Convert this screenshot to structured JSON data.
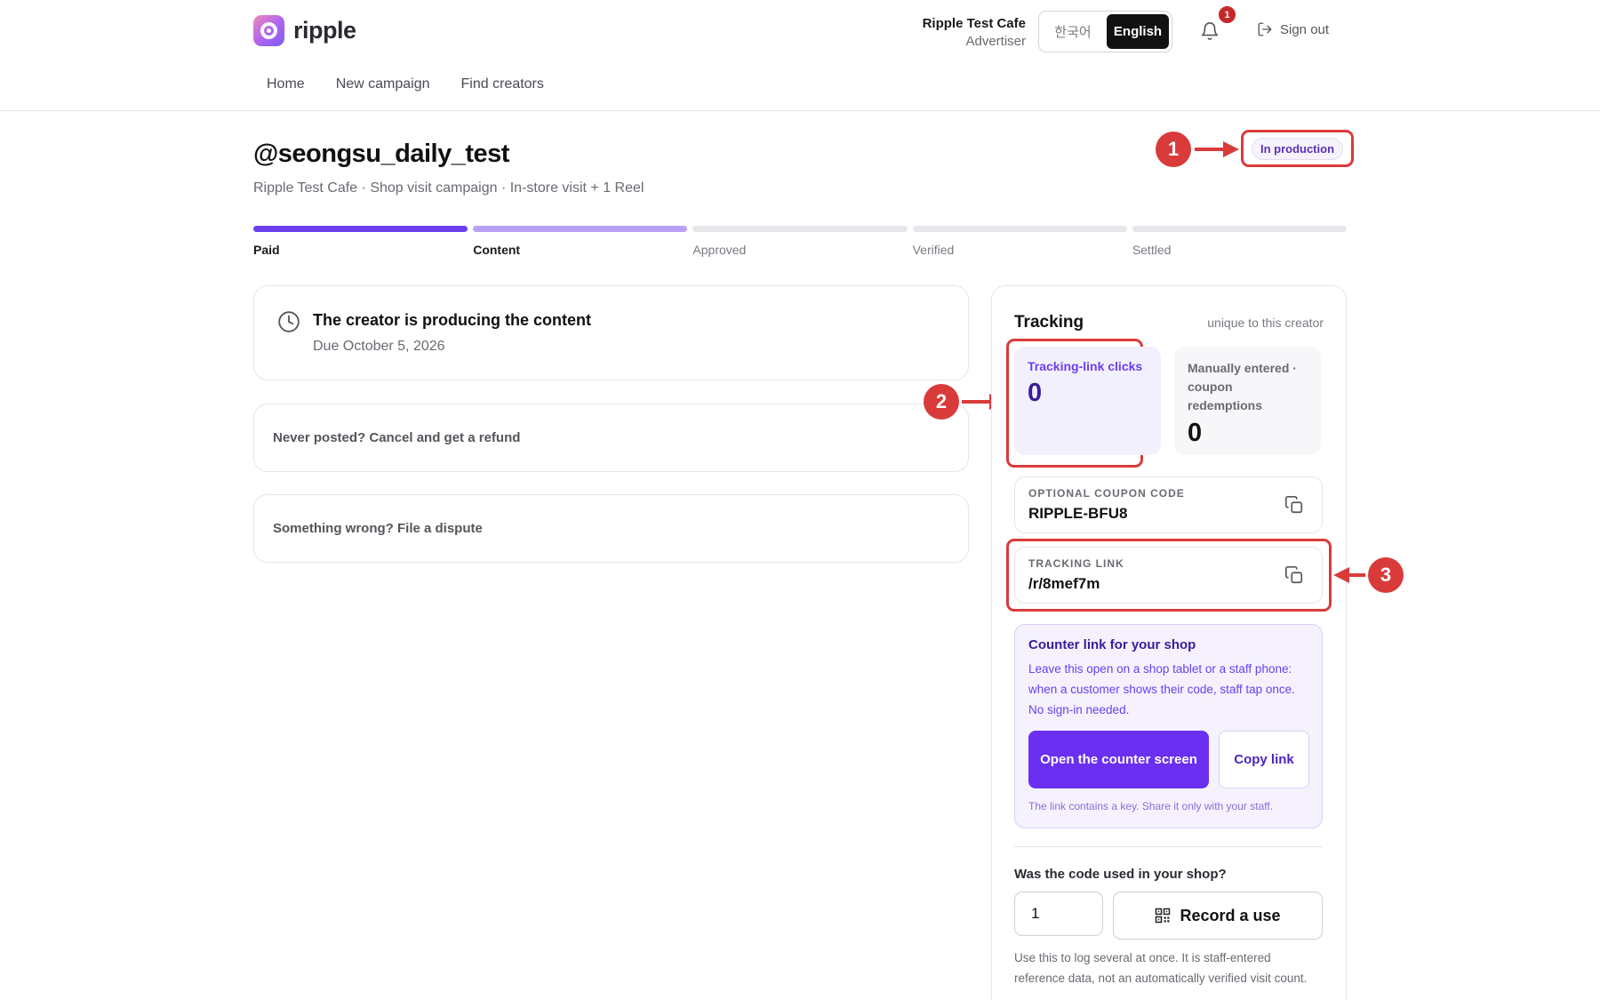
{
  "app": {
    "logo_text": "ripple"
  },
  "account": {
    "name": "Ripple Test Cafe",
    "role": "Advertiser"
  },
  "language": {
    "korean": "한국어",
    "english": "English",
    "selected": "English"
  },
  "notifications": {
    "count": "1"
  },
  "signout_label": "Sign out",
  "nav": {
    "home": "Home",
    "new_campaign": "New campaign",
    "find_creators": "Find creators"
  },
  "campaign": {
    "handle": "@seongsu_daily_test",
    "subtitle": "Ripple Test Cafe · Shop visit campaign · In-store visit + 1 Reel",
    "status": "In production"
  },
  "progress": {
    "steps": [
      {
        "label": "Paid",
        "state": "done"
      },
      {
        "label": "Content",
        "state": "current"
      },
      {
        "label": "Approved",
        "state": "pending"
      },
      {
        "label": "Verified",
        "state": "pending"
      },
      {
        "label": "Settled",
        "state": "pending"
      }
    ]
  },
  "status_card": {
    "title": "The creator is producing the content",
    "due": "Due October 5, 2026"
  },
  "refund_card": {
    "label": "Never posted? Cancel and get a refund"
  },
  "dispute_card": {
    "label": "Something wrong? File a dispute"
  },
  "tracking": {
    "title": "Tracking",
    "subtitle": "unique to this creator",
    "clicks_label": "Tracking-link clicks",
    "clicks_value": "0",
    "coupon_label": "Manually entered · coupon redemptions",
    "coupon_value": "0",
    "coupon_code_label": "OPTIONAL COUPON CODE",
    "coupon_code": "RIPPLE-BFU8",
    "link_label": "TRACKING LINK",
    "link": "/r/8mef7m"
  },
  "counter": {
    "title": "Counter link for your shop",
    "description": "Leave this open on a shop tablet or a staff phone: when a customer shows their code, staff tap once. No sign-in needed.",
    "open_button": "Open the counter screen",
    "copy_button": "Copy link",
    "note": "The link contains a key. Share it only with your staff."
  },
  "usage": {
    "question": "Was the code used in your shop?",
    "quantity": "1",
    "record_button": "Record a use",
    "footnote": "Use this to log several at once. It is staff-entered reference data, not an automatically verified visit count."
  },
  "annotations": {
    "m1": "1",
    "m2": "2",
    "m3": "3"
  },
  "colors": {
    "accent": "#6a2ff0",
    "annotation": "#d93b3b",
    "badge": "#c62828"
  }
}
